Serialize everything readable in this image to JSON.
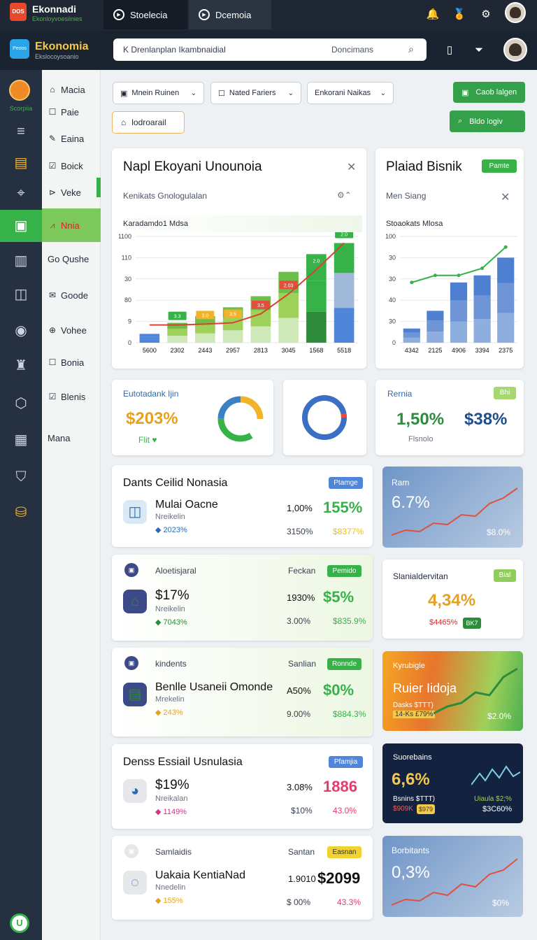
{
  "topbar": {
    "app_title": "Ekonnadi",
    "app_sub": "Ekonloyvoesiinies",
    "logo_text": "DOS",
    "tabs": [
      {
        "label": "Stoelecia"
      },
      {
        "label": "Dcemoia"
      }
    ]
  },
  "header": {
    "brand": "Ekonomia",
    "brand_sub": "Ekslocoysoanio",
    "logo_text": "Peoos",
    "search_value": "K Drenlanplan Ikambnaidial",
    "search_placeholder": "Doncimans"
  },
  "rail": {
    "top_label": "Scorpiia"
  },
  "nav": {
    "items": [
      {
        "label": "Macia",
        "icon": "home-icon"
      },
      {
        "label": "Paie",
        "icon": "square-icon"
      },
      {
        "label": "Eaina",
        "icon": "pen-icon"
      },
      {
        "label": "Boick",
        "icon": "edit-icon"
      },
      {
        "label": "Veke",
        "icon": "share-icon"
      },
      {
        "label": "Nnia",
        "icon": "chart-icon"
      },
      {
        "label": "Go Qushe",
        "icon": ""
      },
      {
        "label": "Goode",
        "icon": "mail-icon"
      },
      {
        "label": "Vohee",
        "icon": "globe-icon"
      },
      {
        "label": "Bonia",
        "icon": "square-icon"
      },
      {
        "label": "Blenis",
        "icon": "edit-icon"
      },
      {
        "label": "Mana",
        "icon": ""
      }
    ]
  },
  "filters": {
    "f1": "Mnein Ruinen",
    "f2": "Nated Fariers",
    "f3": "Enkorani Naikas",
    "dashboard": "lodroarail",
    "btn1": "Caob lalgen",
    "btn2": "Bldo logiv"
  },
  "chart_card": {
    "title": "Napl Ekoyani Unounoia",
    "subtitle": "Kenikats Gnologulalan",
    "legend": "Karadamdo1 Mdsa"
  },
  "chart_data": [
    {
      "type": "bar",
      "yticks": [
        "1100",
        "110",
        "30",
        "80",
        "9",
        "0"
      ],
      "categories": [
        "5600",
        "2302",
        "2443",
        "2957",
        "2813",
        "3045",
        "1568",
        "5518"
      ],
      "values": [
        20,
        45,
        60,
        80,
        105,
        160,
        200,
        225
      ],
      "series_line": [
        40,
        40,
        42,
        45,
        65,
        110,
        165,
        225
      ],
      "labels": [
        "",
        "3.3",
        "3.0",
        "3.5",
        "3.5",
        "2.03",
        "2.0",
        "2.0"
      ],
      "ylim": [
        0,
        240
      ]
    },
    {
      "type": "bar",
      "title": "Stoaokats Mlosa",
      "yticks": [
        "100",
        "30",
        "30",
        "40",
        "30",
        "0"
      ],
      "categories": [
        "4342",
        "2125",
        "4906",
        "3394",
        "2375"
      ],
      "values": [
        20,
        45,
        85,
        95,
        120
      ],
      "series_line": [
        85,
        95,
        95,
        105,
        135
      ],
      "ylim": [
        0,
        150
      ]
    }
  ],
  "side_card": {
    "title": "Plaiad Bisnik",
    "badge": "Pamte",
    "subtitle": "Men Siang"
  },
  "kpi1": {
    "label": "Eutotadank Ijin",
    "value": "$203%",
    "foot": "Flit"
  },
  "kpi3": {
    "label": "Rernia",
    "badge": "Bhi",
    "value1": "1,50%",
    "value2": "$38%",
    "foot": "Flsnolo"
  },
  "rows": [
    {
      "title": "Dants Ceilid Nonasia",
      "badge": "Ptamge",
      "name": "Mulai Oacne",
      "sub": "Nreikelin",
      "delta": "2023%",
      "pct": "1,00%",
      "pct2": "3150%",
      "value": "155%",
      "value2": "$8377%"
    },
    {
      "title": "Aloetisjaral",
      "right": "Feckan",
      "badge": "Pemido",
      "name": "$17%",
      "sub": "Nreikelin",
      "delta": "7043%",
      "pct": "1930%",
      "pct2": "3.00%",
      "value": "$5%",
      "value2": "$835.9%"
    },
    {
      "title": "kindents",
      "right": "Sanlian",
      "badge": "Ronnde",
      "name": "Benlle Usaneii Omonde",
      "sub": "Mrekelin",
      "delta": "243%",
      "pct": "A50%",
      "pct2": "9.00%",
      "value": "$0%",
      "value2": "$884.3%"
    },
    {
      "title": "Denss Essiail Usnulasia",
      "badge": "Pfamjia",
      "name": "$19%",
      "sub": "Nreikalan",
      "delta": "1149%",
      "pct": "3.08%",
      "pct2": "$10%",
      "value": "1886",
      "value2": "43.0%"
    },
    {
      "title": "Samlaidis",
      "right": "Santan",
      "badge": "Easnan",
      "name": "Uakaia KentiaNad",
      "sub": "Nnedelin",
      "delta": "155%",
      "pct": "1.9010",
      "pct2": "$ 00%",
      "value": "$2099",
      "value2": "43.3%"
    }
  ],
  "tiles": [
    {
      "label": "Ram",
      "value": "6.7%",
      "foot": "$8.0%"
    },
    {
      "label": "Slanialdervitan",
      "badge": "Bial",
      "value": "4,34%",
      "foot": "$4465%",
      "foot_badge": "BK7"
    },
    {
      "label": "Kyrubigle",
      "title": "Ruier Iidoja",
      "line1": "Dasks $TTT)",
      "line2": "14-Ks £79%",
      "foot": "$2.0%"
    },
    {
      "label": "Suorebains",
      "value": "6,6%",
      "line1": "Bsnins $TTT)",
      "line2": "$909K",
      "badge": "$979",
      "right1": "Uiaula $2;%",
      "right2": "$3C60%"
    },
    {
      "label": "Borbitants",
      "value": "0,3%",
      "foot": "$0%"
    }
  ],
  "colors": {
    "green": "#36b249",
    "topbar": "#1e2733",
    "rail": "#253141"
  }
}
